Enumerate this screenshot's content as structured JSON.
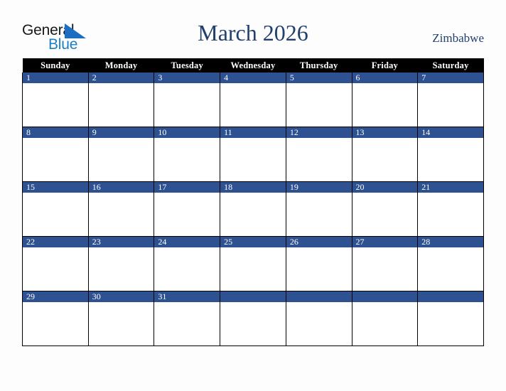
{
  "brand": {
    "name_top": "General",
    "name_bottom": "Blue",
    "top_color": "#16181a",
    "bottom_color": "#1b7fc4",
    "triangle_color": "#1b6ec2",
    "triangle_icon": "triangle-icon"
  },
  "header": {
    "title": "March 2026",
    "country": "Zimbabwe",
    "title_color": "#22406e"
  },
  "colors": {
    "background": "#fdfdfd",
    "weekday_header_bg": "#000000",
    "weekday_header_text": "#ffffff",
    "day_band_bg": "#2e5291",
    "day_band_text": "#ffffff",
    "cell_bg": "#ffffff",
    "grid_line": "#000000"
  },
  "calendar": {
    "month": "March",
    "year": "2026",
    "weekdays": [
      "Sunday",
      "Monday",
      "Tuesday",
      "Wednesday",
      "Thursday",
      "Friday",
      "Saturday"
    ],
    "weeks": [
      [
        {
          "day": "1"
        },
        {
          "day": "2"
        },
        {
          "day": "3"
        },
        {
          "day": "4"
        },
        {
          "day": "5"
        },
        {
          "day": "6"
        },
        {
          "day": "7"
        }
      ],
      [
        {
          "day": "8"
        },
        {
          "day": "9"
        },
        {
          "day": "10"
        },
        {
          "day": "11"
        },
        {
          "day": "12"
        },
        {
          "day": "13"
        },
        {
          "day": "14"
        }
      ],
      [
        {
          "day": "15"
        },
        {
          "day": "16"
        },
        {
          "day": "17"
        },
        {
          "day": "18"
        },
        {
          "day": "19"
        },
        {
          "day": "20"
        },
        {
          "day": "21"
        }
      ],
      [
        {
          "day": "22"
        },
        {
          "day": "23"
        },
        {
          "day": "24"
        },
        {
          "day": "25"
        },
        {
          "day": "26"
        },
        {
          "day": "27"
        },
        {
          "day": "28"
        }
      ],
      [
        {
          "day": "29"
        },
        {
          "day": "30"
        },
        {
          "day": "31"
        },
        {
          "day": ""
        },
        {
          "day": ""
        },
        {
          "day": ""
        },
        {
          "day": ""
        }
      ]
    ]
  }
}
